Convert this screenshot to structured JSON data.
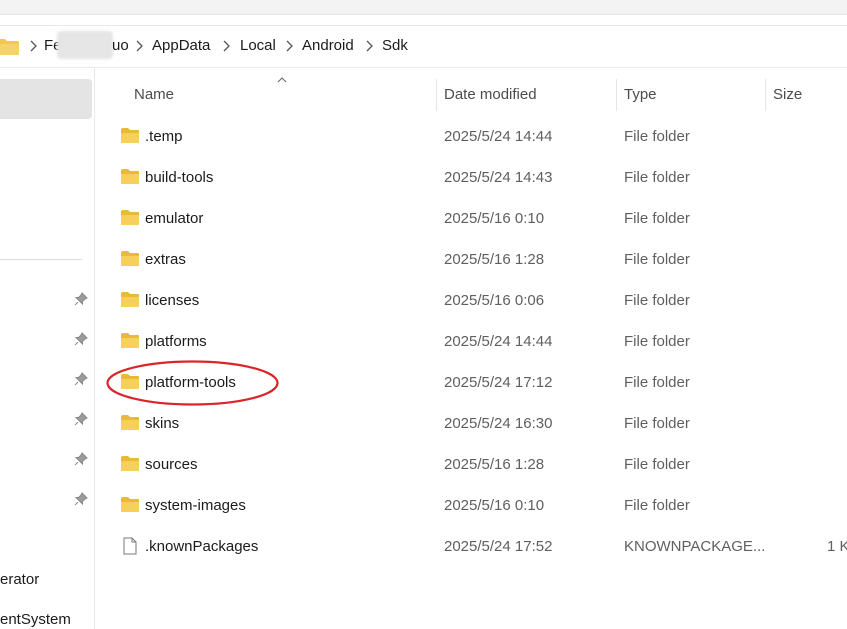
{
  "breadcrumb": {
    "items": [
      "Fe",
      "uo",
      "AppData",
      "Local",
      "Android",
      "Sdk"
    ]
  },
  "nav": {
    "items": [
      "erator",
      "entSystem"
    ]
  },
  "columns": {
    "name": "Name",
    "date": "Date modified",
    "type": "Type",
    "size": "Size"
  },
  "files": [
    {
      "name": ".temp",
      "date": "2025/5/24 14:44",
      "type": "File folder",
      "size": "",
      "icon": "folder-icon"
    },
    {
      "name": "build-tools",
      "date": "2025/5/24 14:43",
      "type": "File folder",
      "size": "",
      "icon": "folder-icon"
    },
    {
      "name": "emulator",
      "date": "2025/5/16 0:10",
      "type": "File folder",
      "size": "",
      "icon": "folder-icon"
    },
    {
      "name": "extras",
      "date": "2025/5/16 1:28",
      "type": "File folder",
      "size": "",
      "icon": "folder-icon"
    },
    {
      "name": "licenses",
      "date": "2025/5/16 0:06",
      "type": "File folder",
      "size": "",
      "icon": "folder-icon"
    },
    {
      "name": "platforms",
      "date": "2025/5/24 14:44",
      "type": "File folder",
      "size": "",
      "icon": "folder-icon"
    },
    {
      "name": "platform-tools",
      "date": "2025/5/24 17:12",
      "type": "File folder",
      "size": "",
      "icon": "folder-icon"
    },
    {
      "name": "skins",
      "date": "2025/5/24 16:30",
      "type": "File folder",
      "size": "",
      "icon": "folder-icon"
    },
    {
      "name": "sources",
      "date": "2025/5/16 1:28",
      "type": "File folder",
      "size": "",
      "icon": "folder-icon"
    },
    {
      "name": "system-images",
      "date": "2025/5/16 0:10",
      "type": "File folder",
      "size": "",
      "icon": "folder-icon"
    },
    {
      "name": ".knownPackages",
      "date": "2025/5/24 17:52",
      "type": "KNOWNPACKAGE...",
      "size": "1 K",
      "icon": "file-icon"
    }
  ],
  "colors": {
    "folder": "#f2c94c",
    "highlight": "#d9262c",
    "selected": "#e4e4e4"
  }
}
